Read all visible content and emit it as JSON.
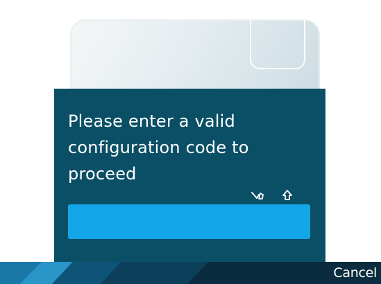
{
  "dialog": {
    "prompt": "Please enter a valid configuration code to proceed",
    "input": {
      "value": "",
      "placeholder": ""
    },
    "input_mode_icons": [
      "predictive-text-icon",
      "shift-icon"
    ]
  },
  "softkeys": {
    "right_label": "Cancel"
  },
  "colors": {
    "dialog_background": "#0b4f66",
    "input_background": "#14a6e8",
    "softkey_bar": "#0a2c3e",
    "text": "#ffffff"
  }
}
